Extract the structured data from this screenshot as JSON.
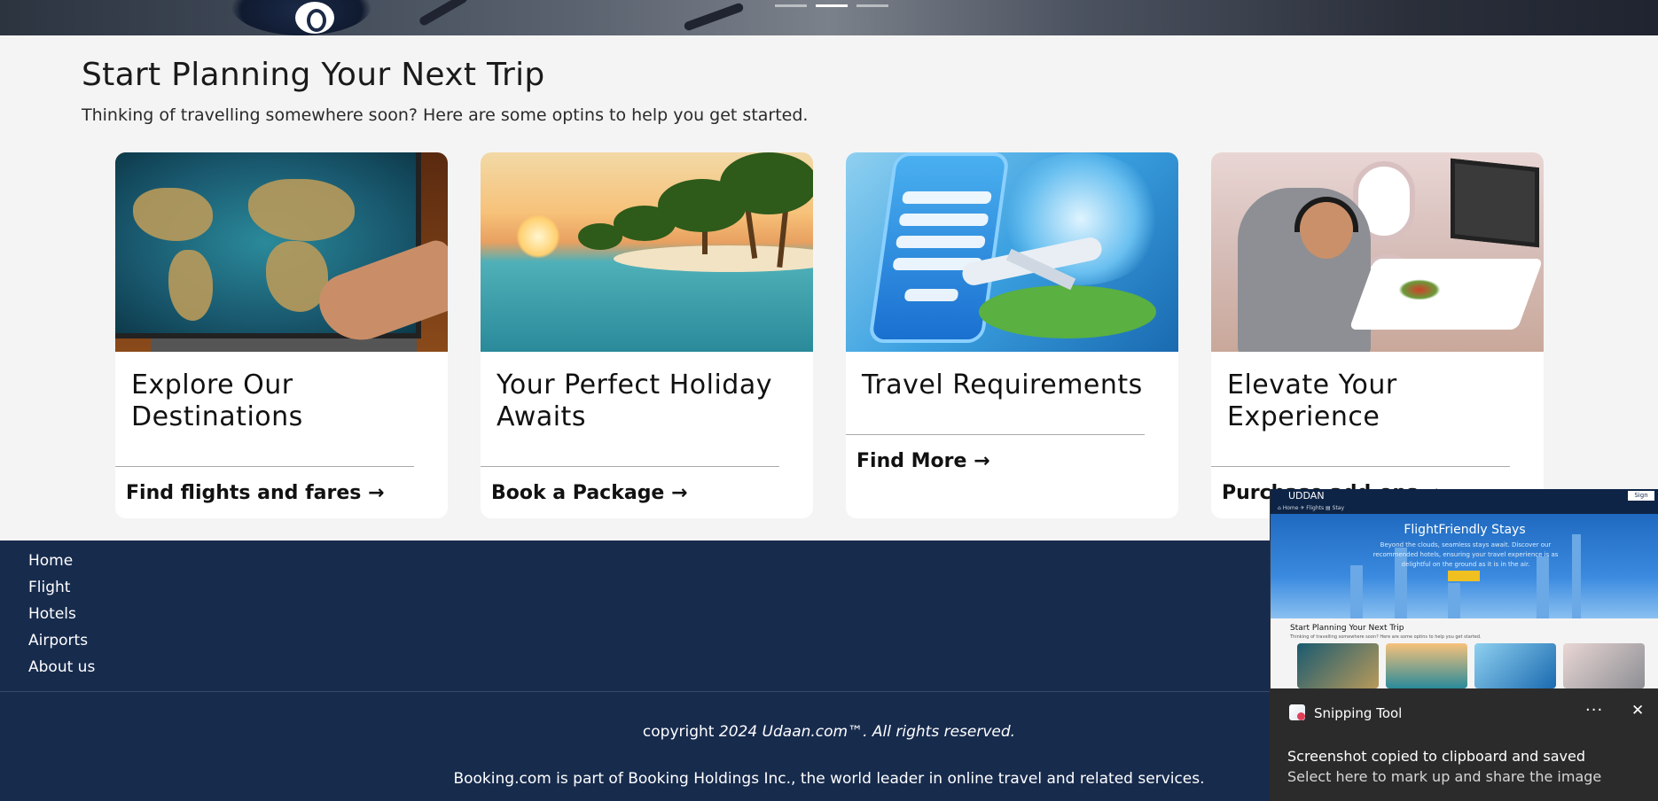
{
  "hero": {
    "slider_dots": 3,
    "active_dot": 1
  },
  "planning": {
    "title": "Start Planning Your Next Trip",
    "subtitle": "Thinking of travelling somewhere soon? Here are some optins to help you get started."
  },
  "cards": [
    {
      "title": "Explore Our Destinations",
      "link": "Find flights and fares →",
      "image": "world-map-laptop"
    },
    {
      "title": "Your Perfect Holiday Awaits",
      "link": "Book a Package →",
      "image": "tropical-beach"
    },
    {
      "title": "Travel Requirements",
      "link": "Find More →",
      "image": "flight-booking-phone"
    },
    {
      "title": "Elevate Your Experience",
      "link": "Purchase add-ons →",
      "image": "inflight-cabin"
    }
  ],
  "footer": {
    "nav": [
      "Home",
      "Flight",
      "Hotels",
      "Airports",
      "About us"
    ],
    "copyright_prefix": "copyright ",
    "copyright_italic": "2024 Udaan.com™. All rights reserved.",
    "booking_note": "Booking.com is part of Booking Holdings Inc., the world leader in online travel and related services."
  },
  "snip_preview": {
    "brand": "UDDAN",
    "nav": "⌂ Home   ✈ Flights   ▤ Stay",
    "signin": "Sign",
    "hero_title": "FlightFriendly Stays",
    "hero_sub": "Beyond the clouds, seamless stays await. Discover our recommended hotels, ensuring your travel experience is as delightful on the ground as it is in the air.",
    "section_title": "Start Planning Your Next Trip",
    "section_sub": "Thinking of travelling somewhere soon? Here are some optins to help you get started."
  },
  "toast": {
    "app_name": "Snipping Tool",
    "more": "···",
    "close": "✕",
    "line1": "Screenshot copied to clipboard and saved",
    "line2": "Select here to mark up and share the image"
  },
  "colors": {
    "footer_bg": "#172b4d",
    "page_bg": "#f4f4f4",
    "toast_bg": "#2b2b2b"
  }
}
